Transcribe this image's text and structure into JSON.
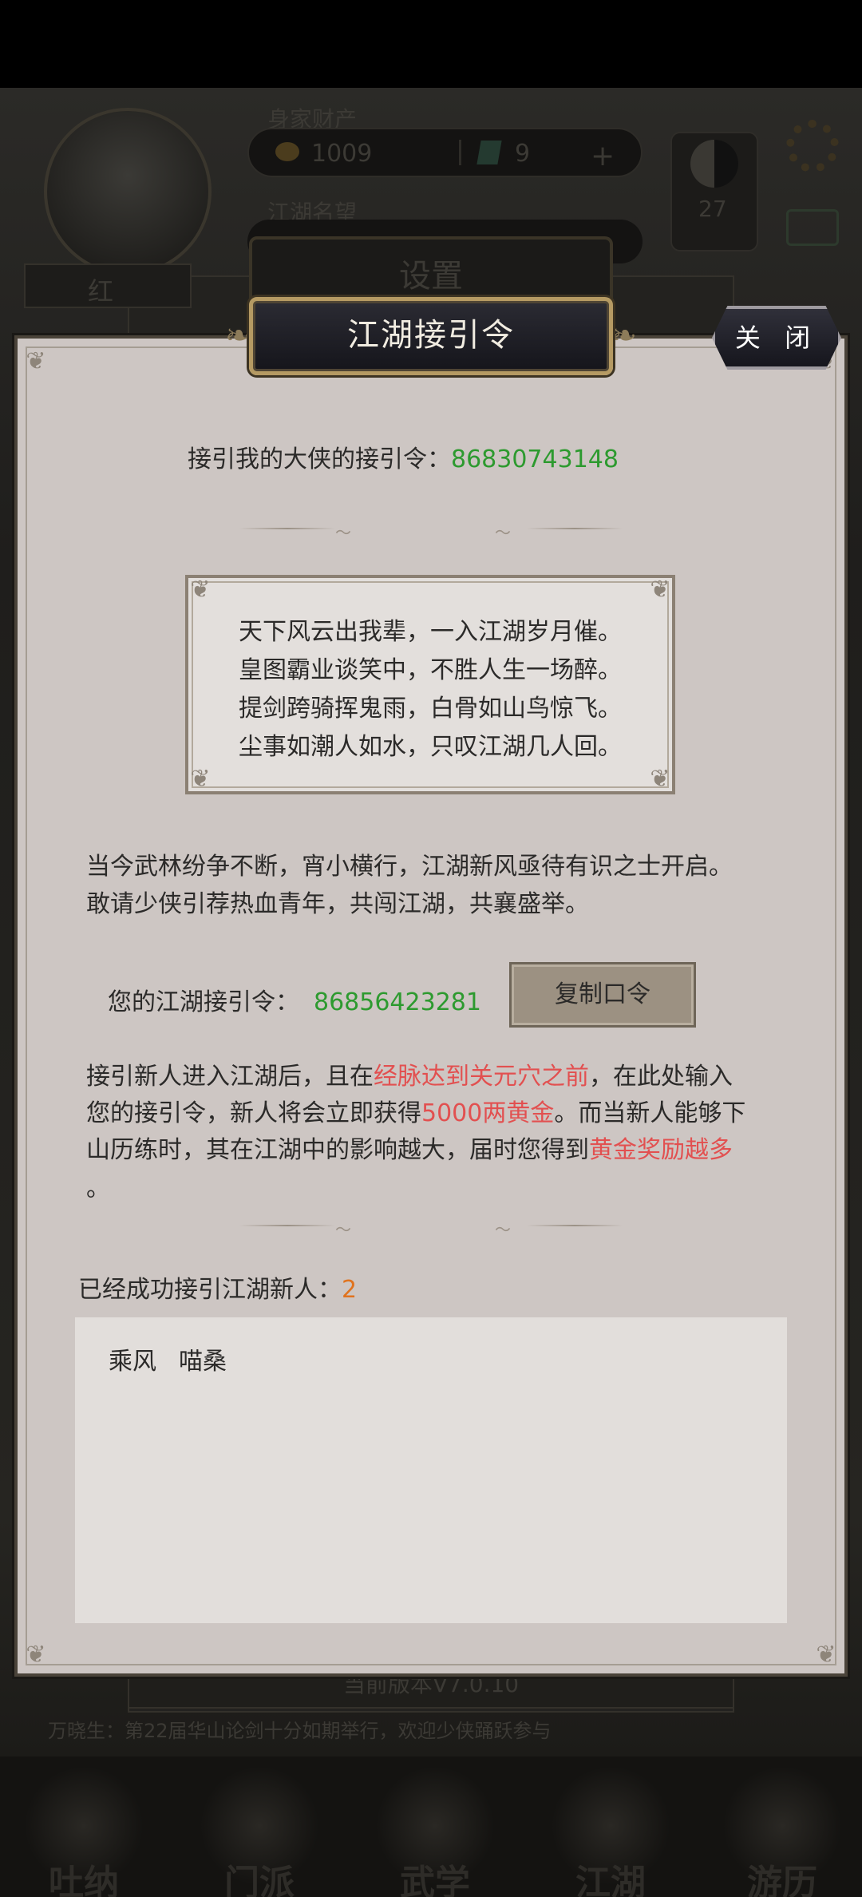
{
  "background": {
    "label_assets": "身家财产",
    "gold_amount": "1009",
    "gem_amount": "9",
    "label_reputation": "江湖名望",
    "level": "27",
    "player_name": "红",
    "settings_title": "设置",
    "version_text": "当前版本V7.0.10",
    "ticker_text": "万晓生：第22届华山论剑十分如期举行，欢迎少侠踊跃参与",
    "nav": [
      "吐纳",
      "门派",
      "武学",
      "江湖",
      "游历"
    ]
  },
  "dialog": {
    "title": "江湖接引令",
    "close_label": "关 闭",
    "inviter_label": "接引我的大侠的接引令：",
    "inviter_code": "86830743148",
    "poem": [
      "天下风云出我辈，一入江湖岁月催。",
      "皇图霸业谈笑中，不胜人生一场醉。",
      "提剑跨骑挥鬼雨，白骨如山鸟惊飞。",
      "尘事如潮人如水，只叹江湖几人回。"
    ],
    "intro_line1": "当今武林纷争不断，宵小横行，江湖新风亟待有识之士开启。",
    "intro_line2": "敢请少侠引荐热血青年，共闯江湖，共襄盛举。",
    "my_code_label": "您的江湖接引令：",
    "my_code": "86856423281",
    "copy_button": "复制口令",
    "rules": {
      "l1a": "接引新人进入江湖后，且在",
      "l1b": "经脉达到关元穴之前",
      "l1c": "，在此处输入",
      "l2a": "您的接引令，新人将会立即获得",
      "l2b": "5000两黄金",
      "l2c": "。而当新人能够下",
      "l3a": "山历练时，其在江湖中的影响越大，届时您得到",
      "l3b": "黄金奖励越多",
      "l4": "。"
    },
    "success_label": "已经成功接引江湖新人：",
    "success_count": "2",
    "invitees": [
      "乘风",
      "喵桑"
    ]
  }
}
